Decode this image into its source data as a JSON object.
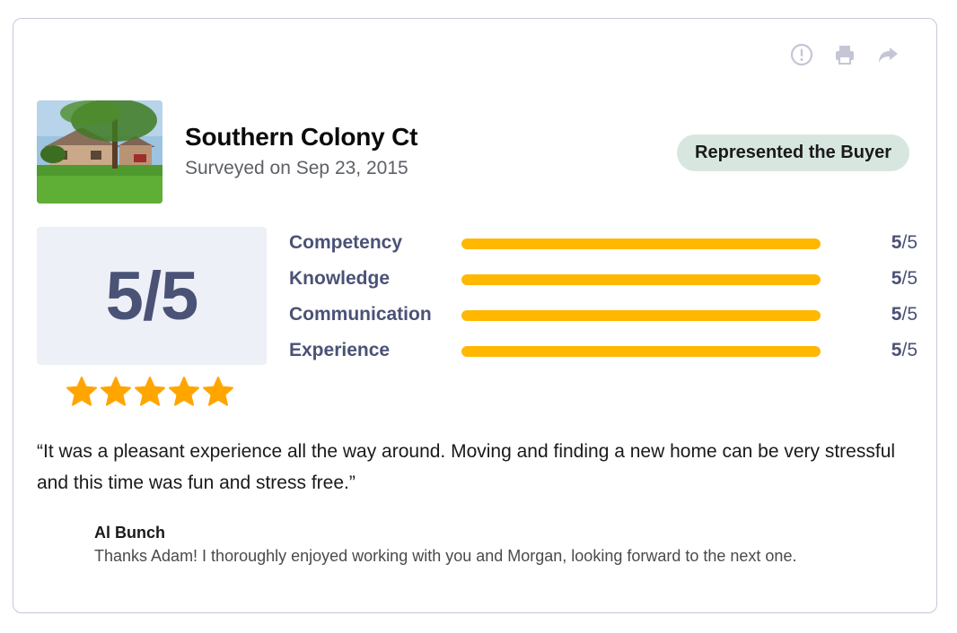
{
  "toolbar": {
    "icons": [
      "report-icon",
      "print-icon",
      "share-icon"
    ],
    "icon_color": "#c4c6d6"
  },
  "listing": {
    "photo_alt": "house-photo",
    "address": "Southern Colony Ct",
    "surveyed": "Surveyed on Sep 23, 2015",
    "badge": "Represented the Buyer"
  },
  "overall": {
    "score": "5/5",
    "stars": 5,
    "star_color": "#ffa500"
  },
  "ratings": [
    {
      "label": "Competency",
      "score": "5",
      "max": "/5",
      "fraction": 1.0
    },
    {
      "label": "Knowledge",
      "score": "5",
      "max": "/5",
      "fraction": 1.0
    },
    {
      "label": "Communication",
      "score": "5",
      "max": "/5",
      "fraction": 1.0
    },
    {
      "label": "Experience",
      "score": "5",
      "max": "/5",
      "fraction": 1.0
    }
  ],
  "colors": {
    "bar": "#ffb700",
    "label": "#4a5276",
    "badge_bg": "#d7e7e0",
    "score_bg": "#eef0f8"
  },
  "review": {
    "text": "“It was a pleasant experience all the way around. Moving and finding a new home can be very stressful and this time was fun and stress free.”"
  },
  "reply": {
    "author": "Al Bunch",
    "text": "Thanks Adam! I thoroughly enjoyed working with you and Morgan, looking forward to the next one."
  }
}
